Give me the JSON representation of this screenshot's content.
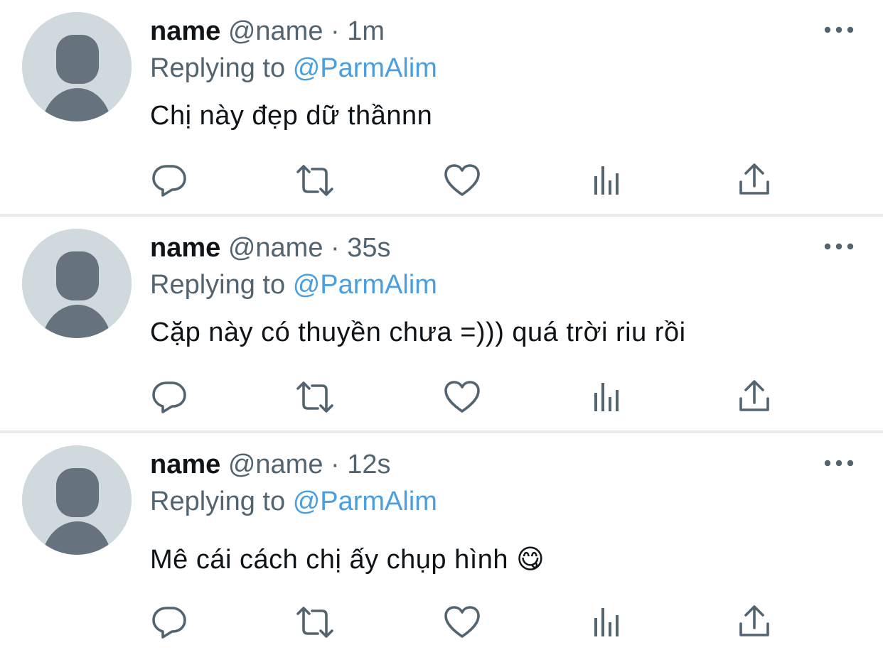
{
  "tweets": [
    {
      "display_name": "name",
      "handle": "@name",
      "separator": "·",
      "time": "1m",
      "replying_prefix": "Replying to",
      "replying_to": "@ParmAlim",
      "text": "Chị này đẹp dữ thầnnn",
      "icons": {
        "more": "more-icon",
        "reply": "reply-icon",
        "retweet": "retweet-icon",
        "like": "heart-icon",
        "views": "analytics-icon",
        "share": "share-icon"
      }
    },
    {
      "display_name": "name",
      "handle": "@name",
      "separator": "·",
      "time": "35s",
      "replying_prefix": "Replying to",
      "replying_to": "@ParmAlim",
      "text": "Cặp này có thuyền chưa =))) quá trời riu rồi",
      "icons": {
        "more": "more-icon",
        "reply": "reply-icon",
        "retweet": "retweet-icon",
        "like": "heart-icon",
        "views": "analytics-icon",
        "share": "share-icon"
      }
    },
    {
      "display_name": "name",
      "handle": "@name",
      "separator": "·",
      "time": "12s",
      "replying_prefix": "Replying to",
      "replying_to": "@ParmAlim",
      "text": "Mê cái cách chị ấy chụp hình 😋",
      "icons": {
        "more": "more-icon",
        "reply": "reply-icon",
        "retweet": "retweet-icon",
        "like": "heart-icon",
        "views": "analytics-icon",
        "share": "share-icon"
      }
    }
  ],
  "colors": {
    "text_primary": "#0f1419",
    "text_secondary": "#536471",
    "mention": "#4a9fe0",
    "avatar_bg": "#cfd9de",
    "avatar_figure": "#66737f",
    "divider": "#e8ebed"
  }
}
